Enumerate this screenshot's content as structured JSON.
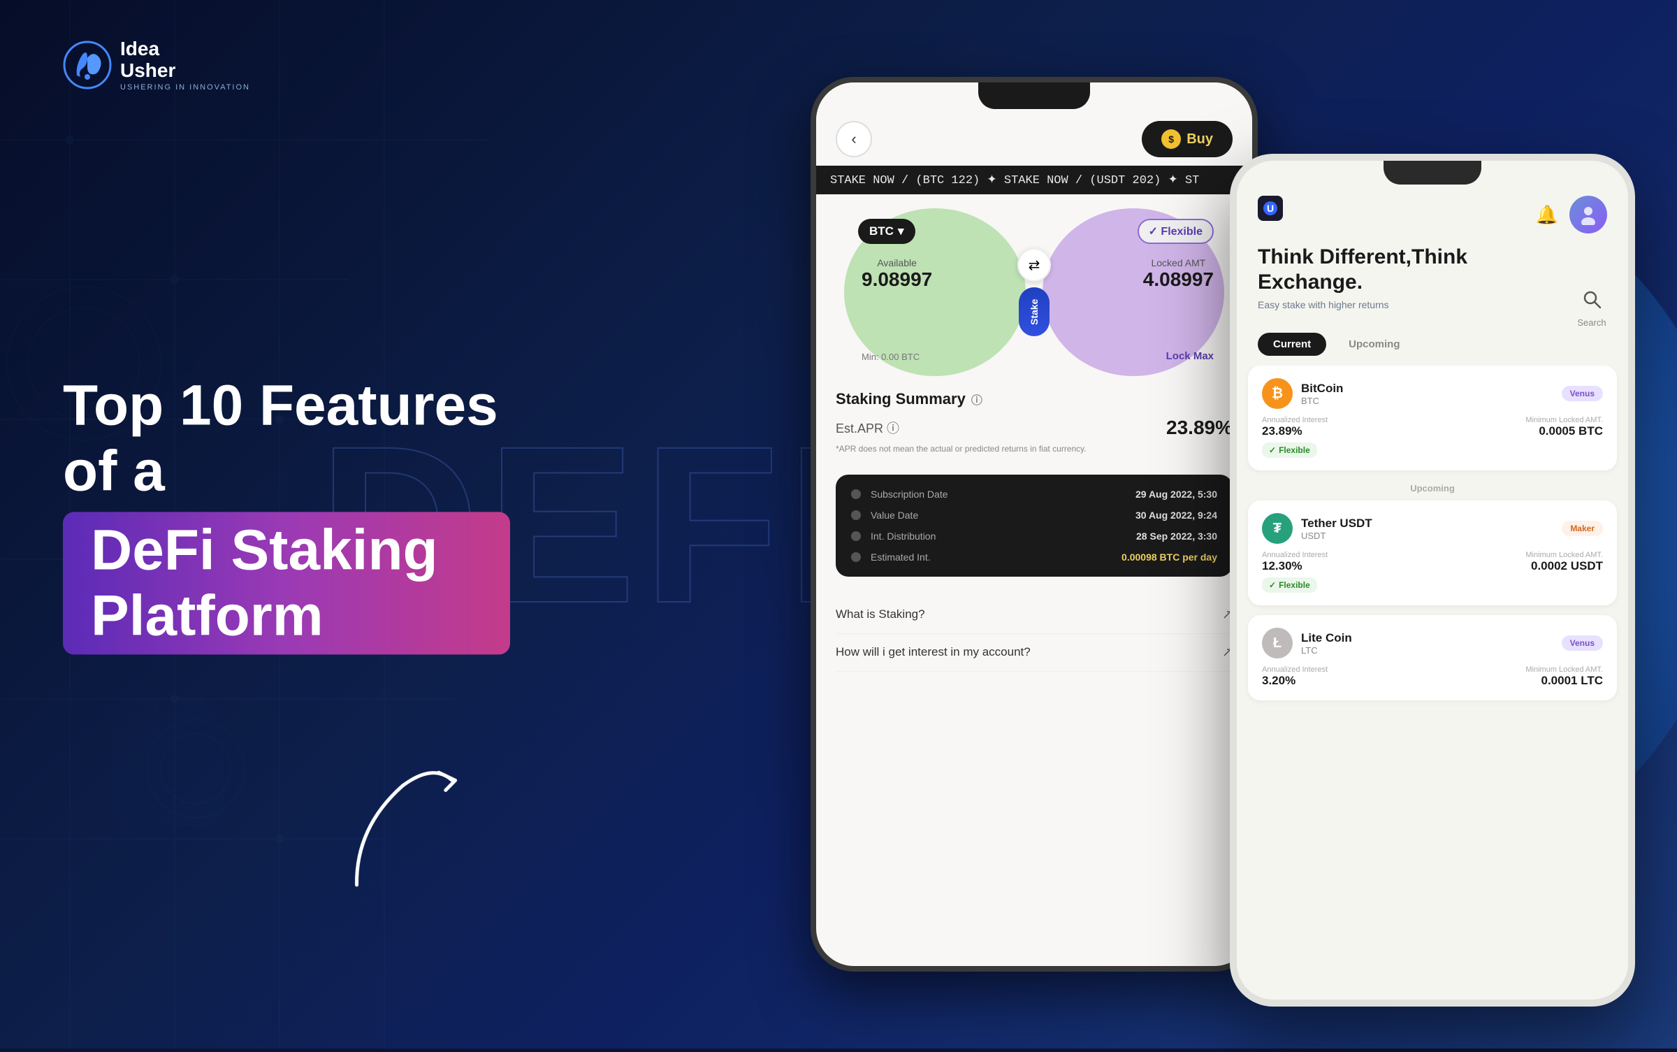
{
  "background": {
    "color": "#0a1535"
  },
  "logo": {
    "idea": "Idea",
    "usher": "Usher",
    "tagline": "USHERING IN INNOVATION"
  },
  "hero": {
    "line1": "Top 10 Features of a",
    "highlight": "DeFi Staking Platform"
  },
  "defi_watermark": "DEFI",
  "phone1": {
    "header": {
      "buy_label": "Buy"
    },
    "ticker": {
      "text1": "STAKE NOW / (BTC 122) ✦ STAKE NOW / (USDT 202) ✦ ST"
    },
    "venn": {
      "btc_label": "BTC",
      "flexible_label": "✓ Flexible",
      "available_label": "Available",
      "available_value": "9.08997",
      "locked_label": "Locked AMT",
      "locked_value": "4.08997",
      "min_label": "Min: 0.00 BTC",
      "lock_max": "Lock Max",
      "stake_label": "Stake"
    },
    "summary": {
      "title": "Staking Summary",
      "apr_label": "Est.APR ⓘ",
      "apr_value": "23.89%",
      "apr_note": "*APR does not mean the actual or predicted returns in fiat currency."
    },
    "info_box": {
      "rows": [
        {
          "label": "Subscription Date",
          "value": "29 Aug 2022, 5:30"
        },
        {
          "label": "Value Date",
          "value": "30 Aug 2022, 9:24"
        },
        {
          "label": "Int. Distribution",
          "value": "28 Sep 2022, 3:30"
        },
        {
          "label": "Estimated Int.",
          "value": "0.00098 BTC per day"
        }
      ]
    },
    "faq": [
      {
        "question": "What is Staking?"
      },
      {
        "question": "How will i get interest in my account?"
      }
    ]
  },
  "phone2": {
    "header": {
      "tagline_line1": "Think Different,Think",
      "tagline_line2": "Exchange.",
      "sub": "Easy stake with higher returns",
      "search_label": "Search"
    },
    "tabs": {
      "current": "Current",
      "upcoming": "Upcoming"
    },
    "coins": [
      {
        "name": "BitCoin",
        "ticker": "BTC",
        "badge": "Venus",
        "badge_type": "venus",
        "apr_label": "Annualized Interest",
        "apr_value": "23.89%",
        "min_label": "Minimum Locked AMT.",
        "min_value": "0.0005 BTC",
        "flexible": true,
        "section": "current",
        "icon": "₿",
        "icon_class": "coin-btc"
      },
      {
        "name": "Tether USDT",
        "ticker": "USDT",
        "badge": "Maker",
        "badge_type": "maker",
        "apr_label": "Annualized Interest",
        "apr_value": "12.30%",
        "min_label": "Minimum Locked AMT.",
        "min_value": "0.0002 USDT",
        "flexible": true,
        "section": "upcoming",
        "icon": "₮",
        "icon_class": "coin-usdt"
      },
      {
        "name": "Lite Coin",
        "ticker": "LTC",
        "badge": "Venus",
        "badge_type": "venus",
        "apr_label": "Annualized Interest",
        "apr_value": "3.20%",
        "min_label": "Minimum Locked AMT.",
        "min_value": "0.0001 LTC",
        "flexible": false,
        "section": "upcoming",
        "icon": "Ł",
        "icon_class": "coin-ltc"
      }
    ]
  }
}
